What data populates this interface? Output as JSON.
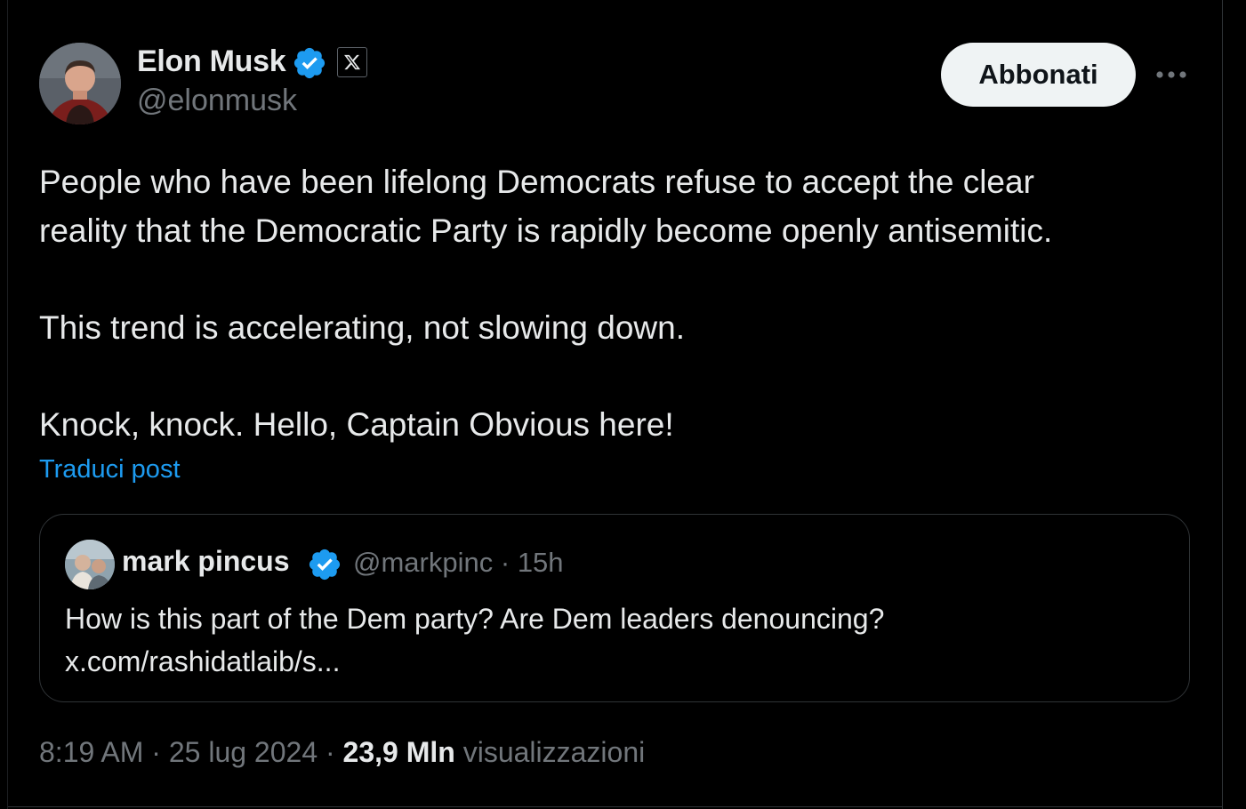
{
  "author": {
    "name": "Elon Musk",
    "handle": "@elonmusk",
    "verified": true,
    "affiliate_badge": "x-logo-icon"
  },
  "actions": {
    "subscribe_label": "Abbonati",
    "more_icon": "more-options-icon"
  },
  "post": {
    "lines": [
      "People who have been lifelong Democrats refuse to accept the clear",
      "reality that the Democratic Party is rapidly become openly antisemitic.",
      "This trend is accelerating, not slowing down.",
      "Knock, knock. Hello, Captain Obvious here!"
    ],
    "translate_label": "Traduci post"
  },
  "quote": {
    "name": "mark pincus",
    "verified": true,
    "handle": "@markpinc",
    "separator": "·",
    "time": "15h",
    "lines": [
      "How is this part of the Dem party? Are Dem leaders denouncing?",
      "x.com/rashidatlaib/s..."
    ]
  },
  "meta": {
    "time": "8:19 AM",
    "separator": "·",
    "date": "25 lug 2024",
    "views_count": "23,9 Mln",
    "views_label": "visualizzazioni"
  },
  "colors": {
    "background": "#000000",
    "text": "#e7e9ea",
    "secondary": "#71767b",
    "accent": "#1d9bf0",
    "border": "#2f3336",
    "button_bg": "#eff3f4"
  }
}
